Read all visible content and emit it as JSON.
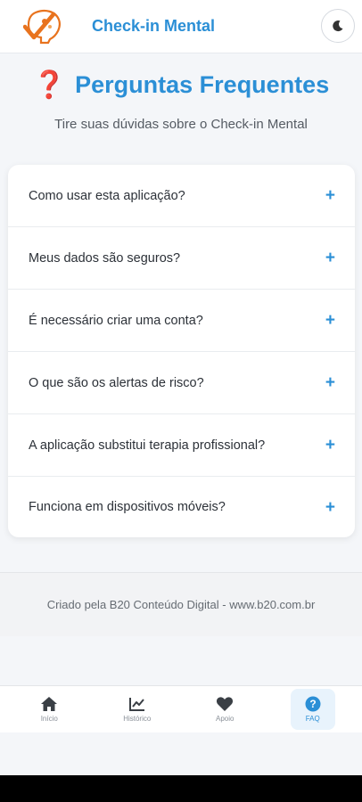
{
  "header": {
    "app_title": "Check-in Mental",
    "logo_icon": "brain-check-logo",
    "theme_icon": "moon-icon"
  },
  "page": {
    "title_icon": "question-mark-icon",
    "title": "Perguntas Frequentes",
    "subtitle": "Tire suas dúvidas sobre o Check-in Mental"
  },
  "faq": {
    "expand_symbol": "+",
    "items": [
      {
        "question": "Como usar esta aplicação?"
      },
      {
        "question": "Meus dados são seguros?"
      },
      {
        "question": "É necessário criar uma conta?"
      },
      {
        "question": "O que são os alertas de risco?"
      },
      {
        "question": "A aplicação substitui terapia profissional?"
      },
      {
        "question": "Funciona em dispositivos móveis?"
      }
    ]
  },
  "footer": {
    "text": "Criado pela B20 Conteúdo Digital - www.b20.com.br"
  },
  "nav": {
    "items": [
      {
        "label": "Início",
        "icon": "home-icon"
      },
      {
        "label": "Histórico",
        "icon": "chart-line-icon"
      },
      {
        "label": "Apoio",
        "icon": "heart-icon"
      },
      {
        "label": "FAQ",
        "icon": "question-circle-icon",
        "active": true
      }
    ]
  },
  "colors": {
    "accent": "#2b8fd6",
    "question_mark": "#d9342b",
    "logo_orange": "#e8731e"
  }
}
